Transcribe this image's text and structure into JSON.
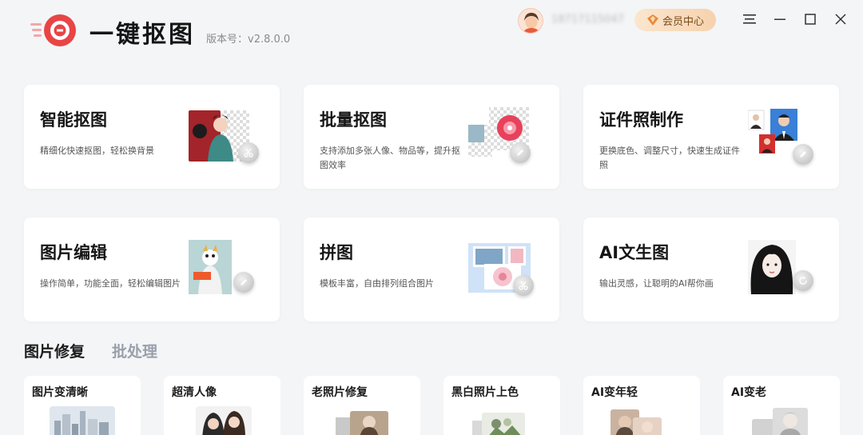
{
  "app": {
    "name": "一键抠图",
    "version": "版本号：v2.8.0.0",
    "username": "18717115047",
    "vip_label": "会员中心",
    "accent": "#e84545"
  },
  "window_controls": [
    "menu-icon",
    "minimize-icon",
    "maximize-icon",
    "close-icon"
  ],
  "features": [
    {
      "title": "智能抠图",
      "desc": "精细化快速抠图，轻松换背景",
      "icon": "smart-cutout-icon"
    },
    {
      "title": "批量抠图",
      "desc": "支持添加多张人像、物品等，提升抠图效率",
      "icon": "batch-cutout-icon"
    },
    {
      "title": "证件照制作",
      "desc": "更换底色、调整尺寸，快速生成证件照",
      "icon": "id-photo-icon"
    },
    {
      "title": "图片编辑",
      "desc": "操作简单，功能全面，轻松编辑图片",
      "icon": "image-edit-icon"
    },
    {
      "title": "拼图",
      "desc": "模板丰富，自由排列组合图片",
      "icon": "collage-icon"
    },
    {
      "title": "AI文生图",
      "desc": "输出灵感，让聪明的AI帮你画",
      "icon": "ai-text-to-image-icon"
    }
  ],
  "tabs": [
    {
      "label": "图片修复",
      "active": true
    },
    {
      "label": "批处理",
      "active": false
    }
  ],
  "tools": [
    {
      "title": "图片变清晰"
    },
    {
      "title": "超清人像"
    },
    {
      "title": "老照片修复"
    },
    {
      "title": "黑白照片上色"
    },
    {
      "title": "AI变年轻"
    },
    {
      "title": "AI变老"
    }
  ]
}
